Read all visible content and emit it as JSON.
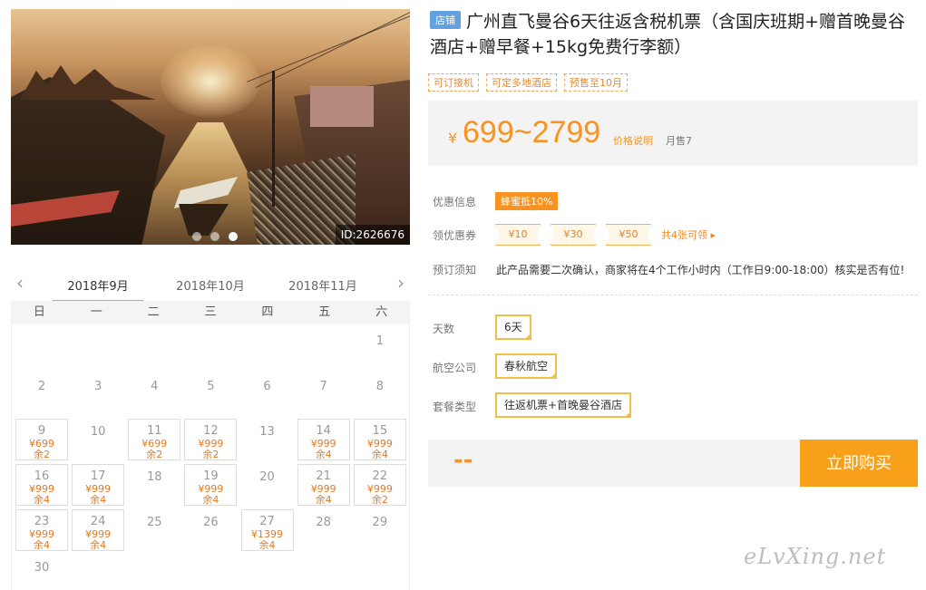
{
  "photo": {
    "id_label": "ID:2626676",
    "slide_count": 3,
    "active_slide": 2
  },
  "calendar": {
    "prev_icon": "chevron-left",
    "next_icon": "chevron-right",
    "months": [
      "2018年9月",
      "2018年10月",
      "2018年11月"
    ],
    "active_month": 0,
    "weekdays": [
      "日",
      "一",
      "二",
      "三",
      "四",
      "五",
      "六"
    ],
    "days": [
      {
        "day": "1",
        "col": 6,
        "row": 0
      },
      {
        "day": "2",
        "col": 0,
        "row": 1
      },
      {
        "day": "3",
        "col": 1,
        "row": 1
      },
      {
        "day": "4",
        "col": 2,
        "row": 1
      },
      {
        "day": "5",
        "col": 3,
        "row": 1
      },
      {
        "day": "6",
        "col": 4,
        "row": 1
      },
      {
        "day": "7",
        "col": 5,
        "row": 1
      },
      {
        "day": "8",
        "col": 6,
        "row": 1
      },
      {
        "day": "9",
        "col": 0,
        "row": 2,
        "price": "¥699",
        "stock": "余2"
      },
      {
        "day": "10",
        "col": 1,
        "row": 2
      },
      {
        "day": "11",
        "col": 2,
        "row": 2,
        "price": "¥699",
        "stock": "余2"
      },
      {
        "day": "12",
        "col": 3,
        "row": 2,
        "price": "¥999",
        "stock": "余2"
      },
      {
        "day": "13",
        "col": 4,
        "row": 2
      },
      {
        "day": "14",
        "col": 5,
        "row": 2,
        "price": "¥999",
        "stock": "余4"
      },
      {
        "day": "15",
        "col": 6,
        "row": 2,
        "price": "¥999",
        "stock": "余4"
      },
      {
        "day": "16",
        "col": 0,
        "row": 3,
        "price": "¥999",
        "stock": "余4"
      },
      {
        "day": "17",
        "col": 1,
        "row": 3,
        "price": "¥999",
        "stock": "余4"
      },
      {
        "day": "18",
        "col": 2,
        "row": 3
      },
      {
        "day": "19",
        "col": 3,
        "row": 3,
        "price": "¥999",
        "stock": "余4"
      },
      {
        "day": "20",
        "col": 4,
        "row": 3
      },
      {
        "day": "21",
        "col": 5,
        "row": 3,
        "price": "¥999",
        "stock": "余4"
      },
      {
        "day": "22",
        "col": 6,
        "row": 3,
        "price": "¥999",
        "stock": "余2"
      },
      {
        "day": "23",
        "col": 0,
        "row": 4,
        "price": "¥999",
        "stock": "余4"
      },
      {
        "day": "24",
        "col": 1,
        "row": 4,
        "price": "¥999",
        "stock": "余4"
      },
      {
        "day": "25",
        "col": 2,
        "row": 4
      },
      {
        "day": "26",
        "col": 3,
        "row": 4
      },
      {
        "day": "27",
        "col": 4,
        "row": 4,
        "price": "¥1399",
        "stock": "余4"
      },
      {
        "day": "28",
        "col": 5,
        "row": 4
      },
      {
        "day": "29",
        "col": 6,
        "row": 4
      },
      {
        "day": "30",
        "col": 0,
        "row": 5
      }
    ]
  },
  "product": {
    "shop_badge": "店铺",
    "title": "广州直飞曼谷6天往返含税机票（含国庆班期+赠首晚曼谷酒店+赠早餐+15kg免费行李额）",
    "tags": [
      "可订接机",
      "可定多地酒店",
      "预售至10月"
    ],
    "price": {
      "currency": "¥",
      "range": "699~2799",
      "note": "价格说明",
      "sold": "月售7"
    },
    "discount": {
      "label": "优惠信息",
      "badge": "蜂蜜抵10%"
    },
    "coupons": {
      "label": "领优惠券",
      "items": [
        "¥10",
        "¥30",
        "¥50"
      ],
      "more": "共4张可领 ▸"
    },
    "notice": {
      "label": "预订须知",
      "text": "此产品需要二次确认，商家将在4个工作小时内（工作日9:00-18:00）核实是否有位!"
    },
    "options": [
      {
        "label": "天数",
        "value": "6天"
      },
      {
        "label": "航空公司",
        "value": "春秋航空"
      },
      {
        "label": "套餐类型",
        "value": "往返机票+首晚曼谷酒店"
      }
    ],
    "buy": {
      "total": "--",
      "button": "立即购买"
    }
  },
  "watermark": "eLvXing.net",
  "colors": {
    "accent": "#f7931e",
    "button": "#f9a01b",
    "badge_blue": "#62a0e0",
    "option_border": "#f1c04b"
  }
}
